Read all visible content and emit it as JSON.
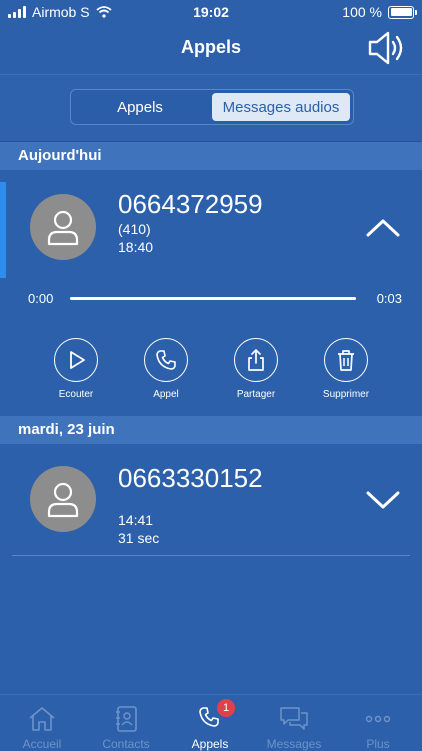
{
  "status_bar": {
    "carrier": "Airmob S",
    "time": "19:02",
    "battery": "100 %"
  },
  "header": {
    "title": "Appels"
  },
  "segment": {
    "tab_calls": "Appels",
    "tab_voicemail": "Messages audios",
    "selected": "Messages audios"
  },
  "sections": [
    {
      "heading": "Aujourd'hui",
      "message": {
        "number": "0664372959",
        "duration_code": "(410)",
        "time": "18:40",
        "expanded": true,
        "player": {
          "start": "0:00",
          "end": "0:03",
          "progress_fraction": 1.0
        },
        "actions": [
          "Ecouter",
          "Appel",
          "Partager",
          "Supprimer"
        ]
      }
    },
    {
      "heading": "mardi, 23 juin",
      "message": {
        "number": "0663330152",
        "time": "14:41",
        "length": "31 sec",
        "expanded": false
      }
    }
  ],
  "tabbar": {
    "items": [
      {
        "label": "Accueil",
        "icon": "home-icon"
      },
      {
        "label": "Contacts",
        "icon": "contacts-icon"
      },
      {
        "label": "Appels",
        "icon": "phone-icon",
        "badge": "1",
        "active": true
      },
      {
        "label": "Messages",
        "icon": "chat-icon"
      },
      {
        "label": "Plus",
        "icon": "more-icon"
      }
    ]
  },
  "colors": {
    "background": "#2c60aa",
    "section": "#3f74bd",
    "accent": "#2f8eed",
    "badge": "#e0404b",
    "avatar": "#8d8d8d"
  }
}
